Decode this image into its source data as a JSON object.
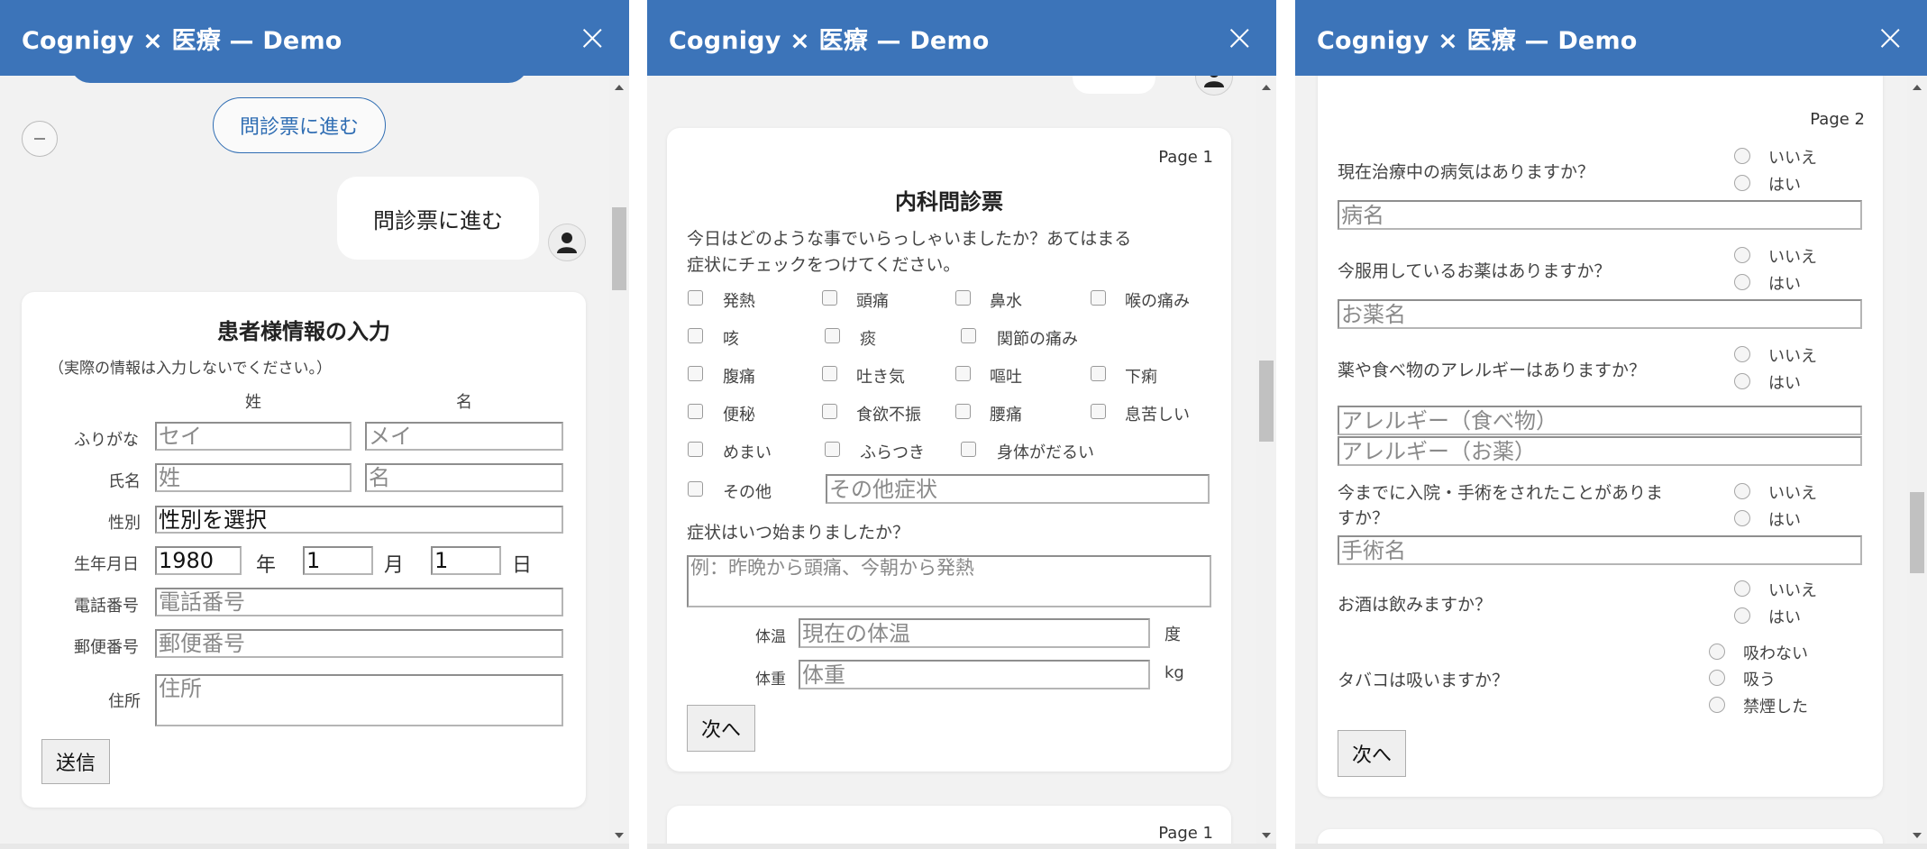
{
  "header": {
    "title": "Cognigy × 医療 — Demo",
    "close": "×"
  },
  "panel1": {
    "quick_reply": "問診票に進む",
    "user_message": "問診票に進む",
    "form": {
      "title": "患者様情報の入力",
      "note": "（実際の情報は入力しないでください。）",
      "col_last": "姓",
      "col_first": "名",
      "furigana_label": "ふりがな",
      "furigana_last_placeholder": "セイ",
      "furigana_first_placeholder": "メイ",
      "name_label": "氏名",
      "name_last_placeholder": "姓",
      "name_first_placeholder": "名",
      "gender_label": "性別",
      "gender_value": "性別を選択",
      "birth_label": "生年月日",
      "birth_year": "1980",
      "year_unit": "年",
      "birth_month": "1",
      "month_unit": "月",
      "birth_day": "1",
      "day_unit": "日",
      "phone_label": "電話番号",
      "phone_placeholder": "電話番号",
      "zip_label": "郵便番号",
      "zip_placeholder": "郵便番号",
      "address_label": "住所",
      "address_placeholder": "住所",
      "submit": "送信"
    }
  },
  "panel2": {
    "page_label": "Page 1",
    "title": "内科問診票",
    "question1_line1": "今日はどのような事でいらっしゃいましたか？あてはまる",
    "question1_line2": "症状にチェックをつけてください。",
    "symptoms": [
      "発熱",
      "頭痛",
      "鼻水",
      "喉の痛み",
      "咳",
      "痰",
      "関節の痛み",
      "腹痛",
      "吐き気",
      "嘔吐",
      "下痢",
      "便秘",
      "食欲不振",
      "腰痛",
      "息苦しい",
      "めまい",
      "ふらつき",
      "身体がだるい",
      "その他"
    ],
    "other_placeholder": "その他症状",
    "question2": "症状はいつ始まりましたか？",
    "onset_placeholder": "例：昨晩から頭痛、今朝から発熱",
    "temp_label": "体温",
    "temp_placeholder": "現在の体温",
    "temp_unit": "度",
    "weight_label": "体重",
    "weight_placeholder": "体重",
    "weight_unit": "kg",
    "next": "次へ",
    "next_page_label": "Page 1"
  },
  "panel3": {
    "page_label": "Page 2",
    "opt_no": "いいえ",
    "opt_yes": "はい",
    "q_disease": "現在治療中の病気はありますか？",
    "disease_placeholder": "病名",
    "q_medicine": "今服用しているお薬はありますか？",
    "medicine_placeholder": "お薬名",
    "q_allergy": "薬や食べ物のアレルギーはありますか？",
    "allergy_food_placeholder": "アレルギー（食べ物）",
    "allergy_drug_placeholder": "アレルギー（お薬）",
    "q_surgery_line1": "今までに入院・手術をされたことがありま",
    "q_surgery_line2": "すか？",
    "surgery_placeholder": "手術名",
    "q_alcohol": "お酒は飲みますか？",
    "q_tobacco": "タバコは吸いますか？",
    "tobacco_no": "吸わない",
    "tobacco_yes": "吸う",
    "tobacco_quit": "禁煙した",
    "next": "次へ"
  },
  "colors": {
    "header": "#3c74b9",
    "background": "#f2f2f2",
    "card": "#ffffff",
    "accent_outline": "#2f6db3"
  }
}
